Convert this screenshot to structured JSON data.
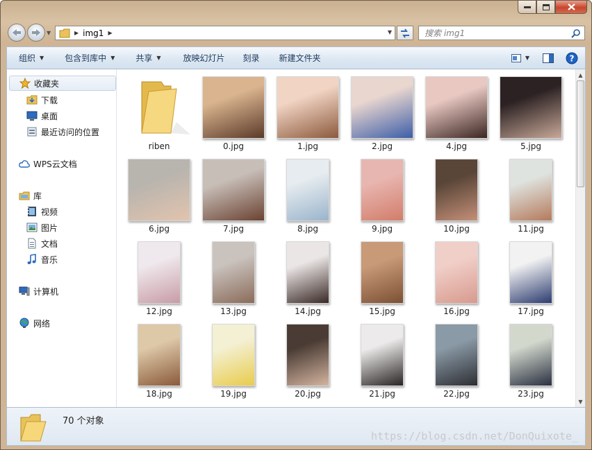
{
  "address": {
    "crumb": "img1"
  },
  "search": {
    "placeholder": "搜索 img1"
  },
  "toolbar": {
    "items": [
      "组织",
      "包含到库中",
      "共享",
      "放映幻灯片",
      "刻录",
      "新建文件夹"
    ]
  },
  "nav": {
    "favorites": "收藏夹",
    "downloads": "下载",
    "desktop": "桌面",
    "recent": "最近访问的位置",
    "wps": "WPS云文档",
    "libraries": "库",
    "videos": "视频",
    "pictures": "图片",
    "documents": "文档",
    "music": "音乐",
    "computer": "计算机",
    "network": "网络"
  },
  "files": [
    {
      "name": "riben",
      "kind": "folder"
    },
    {
      "name": "0.jpg",
      "kind": "land",
      "c1": "#d9b48e",
      "c2": "#5b3a2a"
    },
    {
      "name": "1.jpg",
      "kind": "land",
      "c1": "#f1d4c4",
      "c2": "#8c5a3c"
    },
    {
      "name": "2.jpg",
      "kind": "land",
      "c1": "#e9d6cf",
      "c2": "#3d5ea8"
    },
    {
      "name": "4.jpg",
      "kind": "land",
      "c1": "#e9c8c2",
      "c2": "#3b2622"
    },
    {
      "name": "5.jpg",
      "kind": "land",
      "c1": "#2c2223",
      "c2": "#c8a898"
    },
    {
      "name": "6.jpg",
      "kind": "land",
      "c1": "#b8b4ae",
      "c2": "#e2c4ae"
    },
    {
      "name": "7.jpg",
      "kind": "land",
      "c1": "#c8beb8",
      "c2": "#6a4232"
    },
    {
      "name": "8.jpg",
      "kind": "port",
      "c1": "#e6ecef",
      "c2": "#9ab4cc"
    },
    {
      "name": "9.jpg",
      "kind": "port",
      "c1": "#e8b6b0",
      "c2": "#d27d6a"
    },
    {
      "name": "10.jpg",
      "kind": "port",
      "c1": "#5a4638",
      "c2": "#c48f78"
    },
    {
      "name": "11.jpg",
      "kind": "port",
      "c1": "#dfe3df",
      "c2": "#b47a5c"
    },
    {
      "name": "12.jpg",
      "kind": "port",
      "c1": "#efe8ec",
      "c2": "#c89ca6"
    },
    {
      "name": "13.jpg",
      "kind": "port",
      "c1": "#c9c2bd",
      "c2": "#8b6c5a"
    },
    {
      "name": "14.jpg",
      "kind": "port",
      "c1": "#ebe6e6",
      "c2": "#3a2a26"
    },
    {
      "name": "15.jpg",
      "kind": "port",
      "c1": "#c89a78",
      "c2": "#7c5034"
    },
    {
      "name": "16.jpg",
      "kind": "port",
      "c1": "#f0cfc8",
      "c2": "#d89a8e"
    },
    {
      "name": "17.jpg",
      "kind": "port",
      "c1": "#f2f2f2",
      "c2": "#2c3c70"
    },
    {
      "name": "18.jpg",
      "kind": "port",
      "c1": "#ddc8a8",
      "c2": "#8a5a3a"
    },
    {
      "name": "19.jpg",
      "kind": "port",
      "c1": "#f4f0d4",
      "c2": "#e8cc4c"
    },
    {
      "name": "20.jpg",
      "kind": "port",
      "c1": "#4a3c34",
      "c2": "#d4b4a0"
    },
    {
      "name": "21.jpg",
      "kind": "port",
      "c1": "#eceaea",
      "c2": "#2a2424"
    },
    {
      "name": "22.jpg",
      "kind": "port",
      "c1": "#8a9aa6",
      "c2": "#2e2e34"
    },
    {
      "name": "23.jpg",
      "kind": "port",
      "c1": "#d2d8cc",
      "c2": "#2a3040"
    }
  ],
  "status": {
    "count": "70 个对象"
  },
  "watermark": "https://blog.csdn.net/DonQuixote_",
  "colors": {
    "accent": "#1e395b",
    "selection": "#e5edf6"
  }
}
